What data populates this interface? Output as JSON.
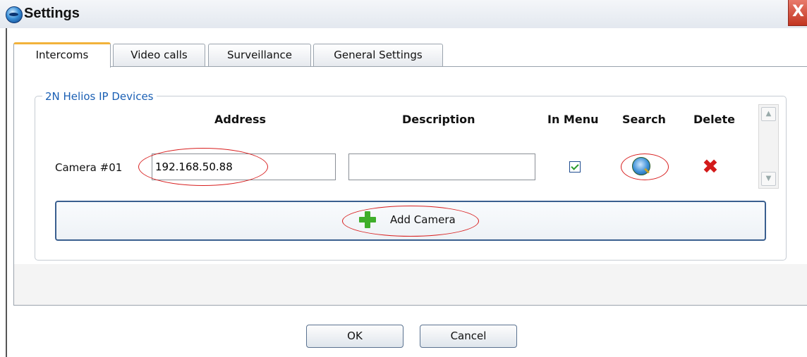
{
  "window": {
    "title": "Settings",
    "close_symbol": "X"
  },
  "tabs": [
    {
      "label": "Intercoms",
      "active": true
    },
    {
      "label": "Video calls",
      "active": false
    },
    {
      "label": "Surveillance",
      "active": false
    },
    {
      "label": "General Settings",
      "active": false
    }
  ],
  "group": {
    "legend": "2N Helios IP Devices",
    "columns": {
      "address": "Address",
      "description": "Description",
      "in_menu": "In Menu",
      "search": "Search",
      "delete": "Delete"
    },
    "rows": [
      {
        "label": "Camera #01",
        "address": "192.168.50.88",
        "description": "",
        "in_menu": true
      }
    ],
    "add_button": "Add Camera"
  },
  "footer": {
    "ok": "OK",
    "cancel": "Cancel"
  },
  "icons": {
    "app": "app-logo-icon",
    "search": "search-globe-icon",
    "delete": "delete-x-icon",
    "add": "plus-icon",
    "close": "close-icon"
  },
  "colors": {
    "highlight": "#d81f1f",
    "legend": "#1a5fb4",
    "active_tab_accent": "#f2b23a"
  }
}
